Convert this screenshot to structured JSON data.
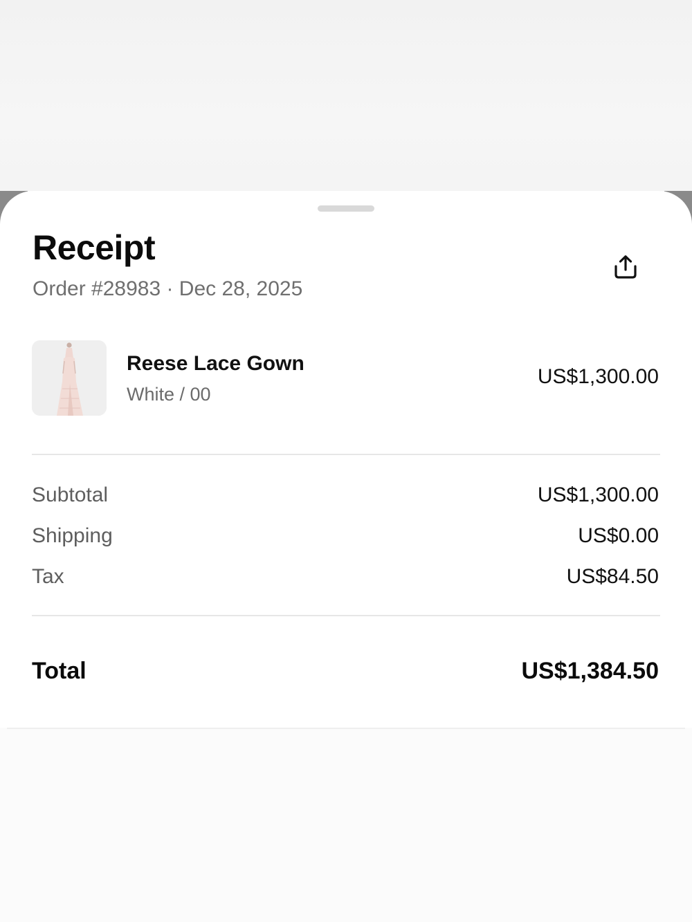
{
  "receipt": {
    "title": "Receipt",
    "order_line": "Order #28983 · Dec 28, 2025"
  },
  "icons": {
    "share": "share-icon",
    "grabber": "sheet-grabber"
  },
  "item": {
    "name": "Reese Lace Gown",
    "variant": "White / 00",
    "price": "US$1,300.00",
    "image": "lace-gown-thumbnail"
  },
  "summary": {
    "rows": [
      {
        "label": "Subtotal",
        "value": "US$1,300.00"
      },
      {
        "label": "Shipping",
        "value": "US$0.00"
      },
      {
        "label": "Tax",
        "value": "US$84.50"
      }
    ],
    "total_label": "Total",
    "total_value": "US$1,384.50"
  },
  "colors": {
    "text_primary": "#111111",
    "text_secondary": "#6f6f6f",
    "divider": "#e6e6e6",
    "sheet_background": "#ffffff"
  }
}
